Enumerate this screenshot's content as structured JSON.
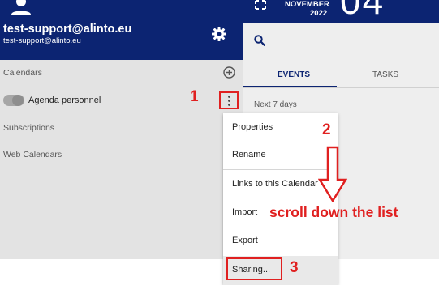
{
  "user": {
    "name": "test-support@alinto.eu",
    "email": "test-support@alinto.eu"
  },
  "header": {
    "month": "NOVEMBER",
    "year": "2022",
    "day": "04"
  },
  "sidebar": {
    "sections": {
      "calendars": "Calendars",
      "subscriptions": "Subscriptions",
      "web_calendars": "Web Calendars"
    },
    "calendar_name": "Agenda personnel"
  },
  "tabs": {
    "events": "EVENTS",
    "tasks": "TASKS"
  },
  "events": {
    "range_label": "Next 7 days"
  },
  "menu": {
    "items": [
      {
        "label": "Properties"
      },
      {
        "label": "Rename"
      },
      {
        "label": "Links to this Calendar"
      },
      {
        "label": "Import"
      },
      {
        "label": "Export"
      },
      {
        "label": "Sharing..."
      }
    ]
  },
  "annotations": {
    "step1": "1",
    "step2": "2",
    "step3": "3",
    "instruction": "scroll down the list"
  },
  "colors": {
    "header_bg": "#0c2472",
    "annotation": "#e02020",
    "panel_bg": "#e3e3e3"
  },
  "icons": [
    "person-icon",
    "gear-icon",
    "expand-icon",
    "search-icon",
    "add-circle-icon",
    "more-vert-icon",
    "down-arrow-icon"
  ]
}
